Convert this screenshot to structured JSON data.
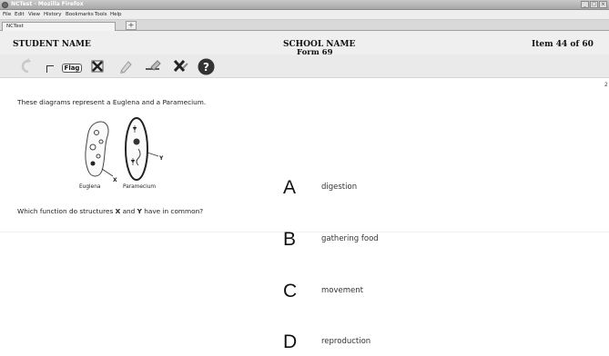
{
  "window": {
    "title": "NCTest - Mozilla Firefox",
    "controls": [
      "_",
      "□",
      "×"
    ]
  },
  "menubar": {
    "items": [
      "File",
      "Edit",
      "View",
      "History",
      "Bookmarks",
      "Tools",
      "Help"
    ]
  },
  "tabs": [
    {
      "label": "NCTest"
    }
  ],
  "new_tab_symbol": "+",
  "test_header": {
    "student_name": "STUDENT NAME",
    "school_name": "SCHOOL NAME",
    "form": "Form 69",
    "item_counter": "Item 44 of 60"
  },
  "toolbar": {
    "flag_label": "Flag",
    "tools": [
      "back-arrow-icon",
      "flag-checkbox",
      "flag-button",
      "cross-off-icon",
      "highlighter-icon",
      "eraser-icon",
      "eliminate-choice-icon",
      "help-icon"
    ]
  },
  "question": {
    "stem": "These diagrams represent a Euglena and a Paramecium.",
    "diagram_labels": {
      "euglena": "Euglena",
      "paramecium": "Paramecium",
      "x": "X",
      "y": "Y"
    },
    "ask_before_x": "Which function do structures ",
    "ask_x": "X",
    "ask_mid": " and ",
    "ask_y": "Y",
    "ask_after": " have in common?"
  },
  "choices": [
    {
      "letter": "A",
      "text": "digestion"
    },
    {
      "letter": "B",
      "text": "gathering food"
    },
    {
      "letter": "C",
      "text": "movement"
    },
    {
      "letter": "D",
      "text": "reproduction"
    }
  ],
  "scroll_indicator": "2"
}
